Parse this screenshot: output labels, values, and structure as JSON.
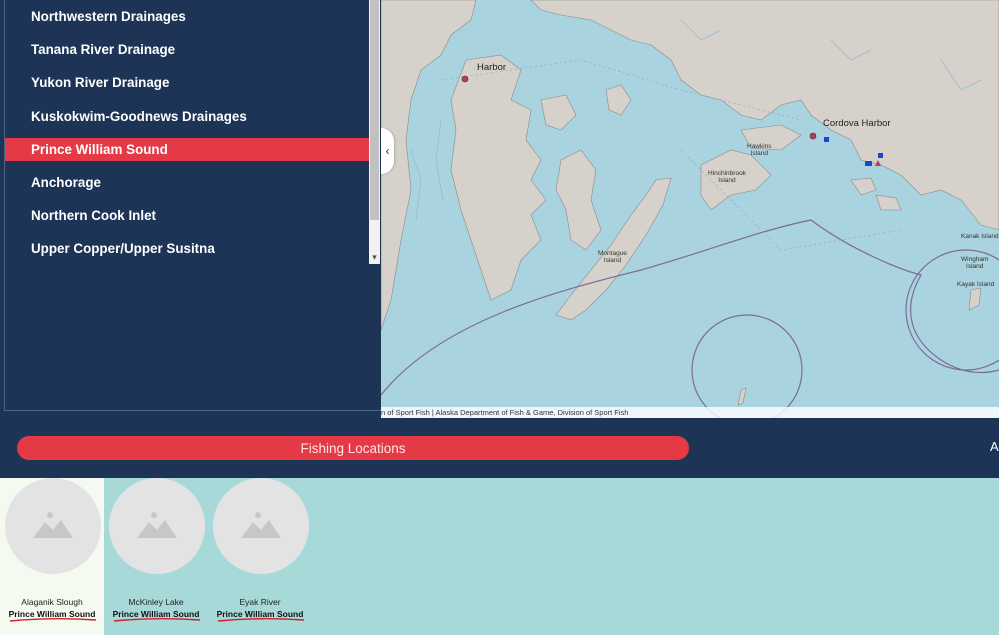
{
  "regions": {
    "items": [
      {
        "label": "Northwestern Drainages",
        "active": false
      },
      {
        "label": "Tanana River Drainage",
        "active": false
      },
      {
        "label": "Yukon River Drainage",
        "active": false
      },
      {
        "label": "Kuskokwim-Goodnews Drainages",
        "active": false
      },
      {
        "label": "Prince William Sound",
        "active": true
      },
      {
        "label": "Anchorage",
        "active": false
      },
      {
        "label": "Northern Cook Inlet",
        "active": false
      },
      {
        "label": "Upper Copper/Upper Susitna",
        "active": false
      }
    ]
  },
  "map": {
    "labels": {
      "harbor": "Harbor",
      "cordova_harbor": "Cordova Harbor",
      "hawkins_island": "Hawkins\nIsland",
      "hinchinbrook_island": "Hinchinbrook\nIsland",
      "montague_island": "Montague\nIsland",
      "kanak_island": "Kanak Island",
      "wingham_island": "Wingham\nIsland",
      "kayak_island": "Kayak Island"
    },
    "attribution": "n of Sport Fish | Alaska Department of Fish & Game, Division of Sport Fish",
    "collapse_glyph": "‹"
  },
  "banner": {
    "button_label": "Fishing Locations",
    "right_text": "A"
  },
  "gallery": {
    "cards": [
      {
        "name": "Alaganik Slough",
        "region": "Prince William Sound",
        "selected": true
      },
      {
        "name": "McKinley Lake",
        "region": "Prince William Sound",
        "selected": false
      },
      {
        "name": "Eyak River",
        "region": "Prince William Sound",
        "selected": false
      }
    ]
  },
  "colors": {
    "navy": "#1d3457",
    "accent_red": "#e63946",
    "water": "#a9d3df",
    "land": "#d6d2cb",
    "gallery_bg": "#a8d9d9",
    "underline_red": "#d0202a"
  }
}
